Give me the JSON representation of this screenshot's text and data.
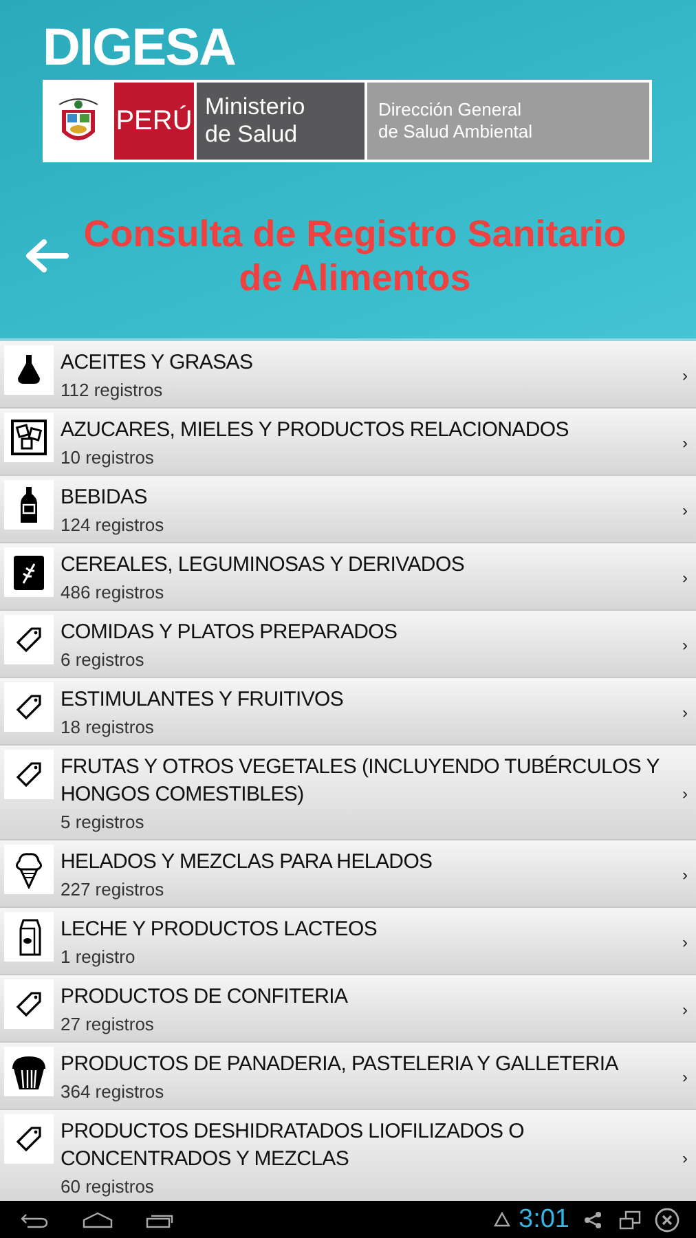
{
  "header": {
    "brand": "DIGESA",
    "logo": {
      "country": "PERÚ",
      "ministry": [
        "Ministerio",
        "de Salud"
      ],
      "directorate": [
        "Dirección General",
        "de Salud Ambiental"
      ]
    },
    "title": "Consulta de Registro Sanitario de Alimentos"
  },
  "categories": [
    {
      "kind": "oil",
      "name": "ACEITES Y GRASAS",
      "count": "112 registros",
      "arrow": "›"
    },
    {
      "kind": "sugar",
      "name": "AZUCARES, MIELES Y PRODUCTOS RELACIONADOS",
      "count": "10 registros",
      "arrow": "›"
    },
    {
      "kind": "bottle",
      "name": "BEBIDAS",
      "count": "124 registros",
      "arrow": "›"
    },
    {
      "kind": "cereal",
      "name": "CEREALES, LEGUMINOSAS Y DERIVADOS",
      "count": "486 registros",
      "arrow": "›"
    },
    {
      "kind": "tag",
      "name": "COMIDAS Y PLATOS PREPARADOS",
      "count": "6 registros",
      "arrow": "›"
    },
    {
      "kind": "tag",
      "name": "ESTIMULANTES Y FRUITIVOS",
      "count": "18 registros",
      "arrow": "›"
    },
    {
      "kind": "tag",
      "name": "FRUTAS Y OTROS VEGETALES (INCLUYENDO TUBÉRCULOS Y HONGOS COMESTIBLES)",
      "count": "5 registros",
      "arrow": "›"
    },
    {
      "kind": "icecream",
      "name": "HELADOS Y MEZCLAS PARA HELADOS",
      "count": "227 registros",
      "arrow": "›"
    },
    {
      "kind": "milk",
      "name": "LECHE Y PRODUCTOS LACTEOS",
      "count": "1 registro",
      "arrow": "›"
    },
    {
      "kind": "tag",
      "name": "PRODUCTOS DE CONFITERIA",
      "count": "27 registros",
      "arrow": "›"
    },
    {
      "kind": "cupcake",
      "name": "PRODUCTOS DE PANADERIA, PASTELERIA Y GALLETERIA",
      "count": "364 registros",
      "arrow": "›"
    },
    {
      "kind": "tag",
      "name": "PRODUCTOS DESHIDRATADOS LIOFILIZADOS O CONCENTRADOS Y MEZCLAS",
      "count": "60 registros",
      "arrow": "›"
    }
  ],
  "status_bar": {
    "time": "3:01"
  }
}
